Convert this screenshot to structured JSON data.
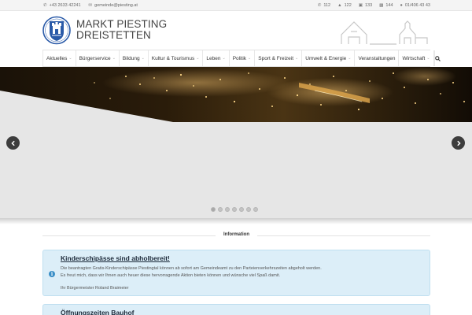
{
  "topbar": {
    "phone": "+43 2633 42241",
    "email": "gemeinde@piesting.at",
    "emergency": [
      {
        "icon": "phone-icon",
        "label": "112"
      },
      {
        "icon": "fire-icon",
        "label": "122"
      },
      {
        "icon": "police-car-icon",
        "label": "133"
      },
      {
        "icon": "ambulance-icon",
        "label": "144"
      },
      {
        "icon": "person-icon",
        "label": "01/406 43 43"
      }
    ]
  },
  "header": {
    "brand_line1": "MARKT PIESTING",
    "brand_line2": "DREISTETTEN"
  },
  "nav": {
    "items": [
      {
        "label": "Aktuelles",
        "dropdown": true
      },
      {
        "label": "Bürgerservice",
        "dropdown": true
      },
      {
        "label": "Bildung",
        "dropdown": true
      },
      {
        "label": "Kultur & Tourismus",
        "dropdown": true
      },
      {
        "label": "Leben",
        "dropdown": true
      },
      {
        "label": "Politik",
        "dropdown": true
      },
      {
        "label": "Sport & Freizeit",
        "dropdown": true
      },
      {
        "label": "Umwelt & Energie",
        "dropdown": true
      },
      {
        "label": "Veranstaltungen",
        "dropdown": false
      },
      {
        "label": "Wirtschaft",
        "dropdown": true
      }
    ],
    "search_icon": "search-icon"
  },
  "slider": {
    "dot_count": 7,
    "active_dot": 0
  },
  "info": {
    "heading": "Information"
  },
  "alerts": [
    {
      "title": "Kinderschipässe sind abholbereit!",
      "line1": "Die beantragten Gratis-Kinderschipässe Piestingtal können ab sofort am Gemeindeamt zu den Parteienverkehrszeiten abgeholt werden.",
      "line2": "Es freut mich, dass wir Ihnen auch heuer diese hervorragende Aktion bieten können und wünsche viel Spaß damit.",
      "line3": "Ihr Bürgermeister Roland Braimeier"
    },
    {
      "title": "Öffnungszeiten Bauhof"
    }
  ],
  "colors": {
    "alert_bg": "#dceef8",
    "alert_icon": "#3a8fc7",
    "slider_bg": "#e6e6e6"
  }
}
